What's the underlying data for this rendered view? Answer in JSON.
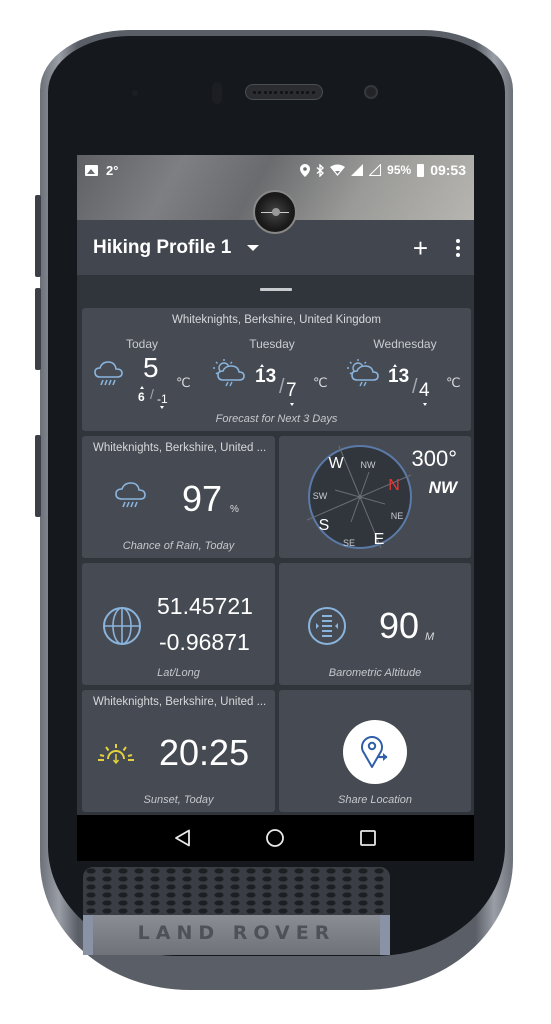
{
  "device": {
    "brand": "LAND ROVER"
  },
  "status_bar": {
    "temperature": "2°",
    "battery": "95%",
    "time": "09:53",
    "icons": [
      "image-icon",
      "location-icon",
      "bluetooth-icon",
      "wifi-icon",
      "signal-icon",
      "signal-empty-icon",
      "battery-icon"
    ]
  },
  "app_bar": {
    "title": "Hiking Profile 1",
    "dropdown_icon": "arrow-drop-down",
    "add_icon": "+",
    "more_icon": "more-vert"
  },
  "forecast_card": {
    "location": "Whiteknights, Berkshire, United Kingdom",
    "caption": "Forecast for Next 3 Days",
    "unit": "℃",
    "days": [
      {
        "name": "Today",
        "icon": "rain-icon",
        "current": "5",
        "high": "6",
        "low": "-1"
      },
      {
        "name": "Tuesday",
        "icon": "sun-cloud-rain-icon",
        "high": "13",
        "low": "7"
      },
      {
        "name": "Wednesday",
        "icon": "sun-cloud-rain-icon",
        "high": "13",
        "low": "4"
      }
    ]
  },
  "rain_card": {
    "location": "Whiteknights, Berkshire, United ...",
    "value": "97",
    "unit": "%",
    "caption": "Chance of Rain, Today"
  },
  "compass_card": {
    "degrees": "300°",
    "direction": "NW",
    "labels": {
      "N": "N",
      "NE": "NE",
      "E": "E",
      "SE": "SE",
      "S": "S",
      "SW": "SW",
      "W": "W",
      "NW": "NW"
    },
    "north_color": "#e53935",
    "ring_color": "#5b7aa8"
  },
  "latlong_card": {
    "lat": "51.45721",
    "long": "-0.96871",
    "caption": "Lat/Long"
  },
  "altitude_card": {
    "value": "90",
    "unit": "M",
    "caption": "Barometric Altitude"
  },
  "sunset_card": {
    "location": "Whiteknights, Berkshire, United ...",
    "time": "20:25",
    "caption": "Sunset, Today",
    "icon_color": "#e3d23a"
  },
  "share_card": {
    "caption": "Share Location",
    "icon_color": "#2f5fa8"
  },
  "nav_bar": {
    "back": "back",
    "home": "home",
    "recents": "recents"
  },
  "accent_color": "#8ab4dc"
}
